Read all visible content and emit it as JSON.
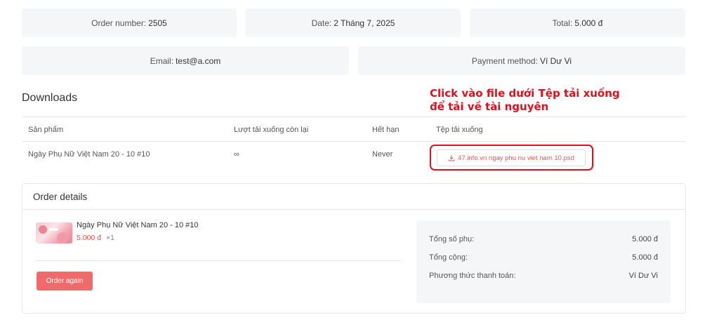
{
  "overview": {
    "order_number_label": "Order number:",
    "order_number": "2505",
    "date_label": "Date:",
    "date": "2 Tháng 7, 2025",
    "total_label": "Total:",
    "total": "5.000 đ",
    "email_label": "Email:",
    "email": "test@a.com",
    "payment_label": "Payment method:",
    "payment": "Ví Dư Vi"
  },
  "downloads": {
    "title": "Downloads",
    "annotation_line1": "Click vào file dưới Tệp tải xuống",
    "annotation_line2": "để tải về tài nguyên",
    "columns": [
      "Sản phẩm",
      "Lượt tải xuống còn lại",
      "Hết hạn",
      "Tệp tải xuống"
    ],
    "row": {
      "product": "Ngày Phụ Nữ Việt Nam 20 - 10 #10",
      "remaining": "∞",
      "expires": "Never",
      "file": "47.info.vn ngay phu nu viet nam 10.psd"
    },
    "icon": "download-icon",
    "highlight_color": "#e0111f"
  },
  "order_details": {
    "title": "Order details",
    "item": {
      "name": "Ngày Phụ Nữ Việt Nam 20 - 10 #10",
      "price": "5.000 đ",
      "qty": "×1"
    },
    "order_again_label": "Order again",
    "summary": [
      {
        "label": "Tổng số phụ:",
        "value": "5.000 đ"
      },
      {
        "label": "Tổng cộng:",
        "value": "5.000 đ"
      },
      {
        "label": "Phương thức thanh toán:",
        "value": "Ví Dư Vi"
      }
    ],
    "accent_color": "#ef6b6b"
  }
}
